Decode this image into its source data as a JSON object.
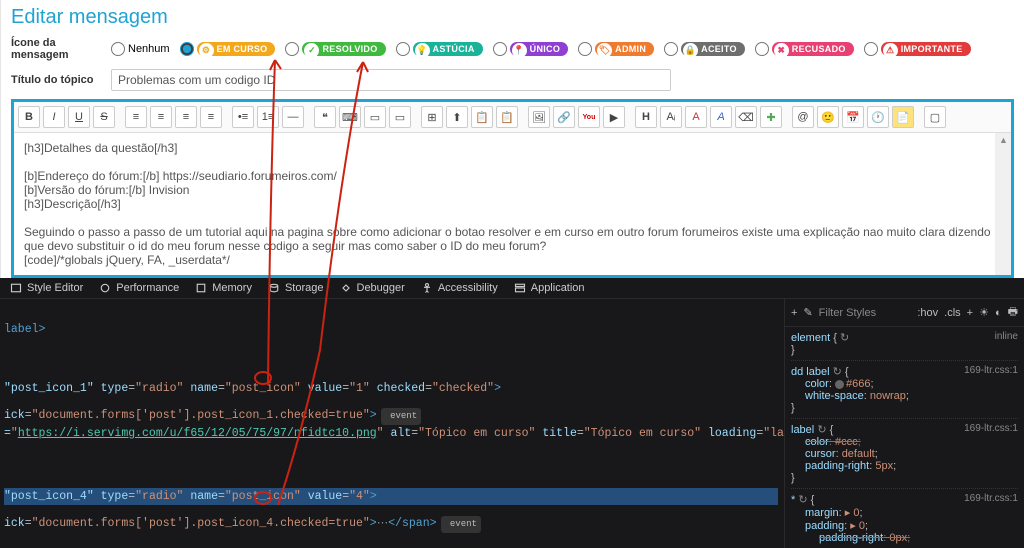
{
  "panel_title": "Editar mensagem",
  "labels": {
    "icon": "Ícone da mensagem",
    "title": "Título do tópico",
    "none": "Nenhum"
  },
  "icons": {
    "em_curso": "EM CURSO",
    "resolvido": "RESOLVIDO",
    "astucia": "ASTÚCIA",
    "unico": "ÚNICO",
    "admin": "ADMIN",
    "aceito": "ACEITO",
    "recusado": "RECUSADO",
    "importante": "IMPORTANTE"
  },
  "title_value": "Problemas com um codigo ID",
  "editor_text": "[h3]Detalhes da questão[/h3]\n\n[b]Endereço do fórum:[/b] https://seudiario.forumeiros.com/\n[b]Versão do fórum:[/b] Invision\n[h3]Descrição[/h3]\n\nSeguindo o passo a passo de um tutorial aqui na pagina sobre como adicionar o botao resolver e em curso em outro forum forumeiros existe uma explicação nao muito clara dizendo que devo substituir o id do meu forum nesse codigo a seguir mas como saber o ID do meu forum?\n[code]/*globals jQuery, FA, _userdata*/",
  "devtools_tabs": {
    "style_editor": "Style Editor",
    "performance": "Performance",
    "memory": "Memory",
    "storage": "Storage",
    "debugger": "Debugger",
    "accessibility": "Accessibility",
    "application": "Application"
  },
  "devtools_source": {
    "l1": "label>",
    "l2": "\"post_icon_1\" type=\"radio\" name=\"post_icon\" value=\"1\" checked=\"checked\">",
    "l3_pre": "ick=\"document.forms['post'].post_icon_1.checked=true\">",
    "l3_post": " event",
    "l4_pre": "=\"",
    "l4_url": "https://i.servimg.com/u/f65/12/05/75/97/nfidtc10.png",
    "l4_post": "\" alt=\"Tópico em curso\" title=\"Tópico em curso\" loading=\"lazy\">",
    "l5": "\"post_icon_4\" type=\"radio\" name=\"post_icon\" value=\"4\">",
    "l6_pre": "ick=\"document.forms['post'].post_icon_4.checked=true\">",
    "l6_mid": "</span>",
    "l6_post": " event"
  },
  "styles_filter": "Filter Styles",
  "styles_pseudo": ":hov",
  "styles_cls": ".cls",
  "styles": {
    "r0_sel": "element",
    "r0_brace": "{",
    "r0_close": "}",
    "inline": "inline",
    "r1_sel": "dd label",
    "r1_src": "169-ltr.css:1",
    "r1_p1": "color",
    "r1_v1": "#666",
    "r1_p2": "white-space",
    "r1_v2": "nowrap",
    "r2_sel": "label",
    "r2_src": "169-ltr.css:1",
    "r2_p1": "color",
    "r2_v1": "#ccc",
    "r2_p2": "cursor",
    "r2_v2": "default",
    "r2_p3": "padding-right",
    "r2_v3": "5px",
    "r3_sel": "*",
    "r3_src": "169-ltr.css:1",
    "r3_p1": "margin",
    "r3_v1": "0",
    "r3_p2": "padding",
    "r3_v2": "0",
    "r3_p3": "padding-right",
    "r3_v3": "0px",
    "triangle": "▸",
    "glyph": "⊕",
    "brace_close": "}"
  }
}
